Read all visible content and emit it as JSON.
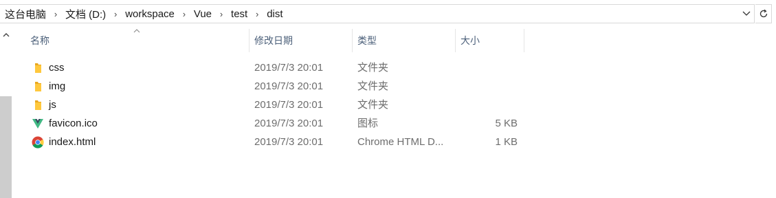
{
  "address": {
    "breadcrumbs": [
      "这台电脑",
      "文档 (D:)",
      "workspace",
      "Vue",
      "test",
      "dist"
    ]
  },
  "columns": {
    "name": "名称",
    "date": "修改日期",
    "type": "类型",
    "size": "大小"
  },
  "files": [
    {
      "name": "css",
      "date": "2019/7/3 20:01",
      "type": "文件夹",
      "size": "",
      "icon": "folder-icon"
    },
    {
      "name": "img",
      "date": "2019/7/3 20:01",
      "type": "文件夹",
      "size": "",
      "icon": "folder-icon"
    },
    {
      "name": "js",
      "date": "2019/7/3 20:01",
      "type": "文件夹",
      "size": "",
      "icon": "folder-icon"
    },
    {
      "name": "favicon.ico",
      "date": "2019/7/3 20:01",
      "type": "图标",
      "size": "5 KB",
      "icon": "vue-logo-icon"
    },
    {
      "name": "index.html",
      "date": "2019/7/3 20:01",
      "type": "Chrome HTML D...",
      "size": "1 KB",
      "icon": "chrome-icon"
    }
  ],
  "colors": {
    "header_text": "#4c607a",
    "secondary_text": "#6d6d6d",
    "folder": "#ffc83d",
    "vue_green": "#41b883",
    "vue_dark": "#35495e"
  }
}
